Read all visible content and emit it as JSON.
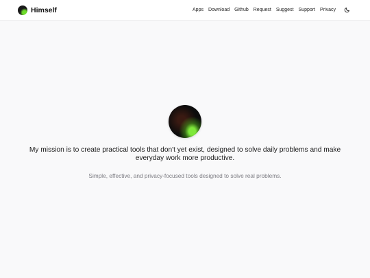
{
  "brand": {
    "name": "Himself",
    "logo_icon": "himself-logo-icon"
  },
  "nav": {
    "items": [
      "Apps",
      "Download",
      "Github",
      "Request",
      "Suggest",
      "Support",
      "Privacy"
    ],
    "theme_icon": "moon-icon"
  },
  "hero": {
    "avatar": "avatar",
    "mission": "My mission is to create practical tools that don't yet exist, designed to solve daily problems and make everyday work more productive.",
    "tagline": "Simple, effective, and privacy-focused tools designed to solve real problems."
  },
  "colors": {
    "background": "#f9f9fa",
    "navbar": "#ffffff",
    "accent": "#6edc2b"
  }
}
